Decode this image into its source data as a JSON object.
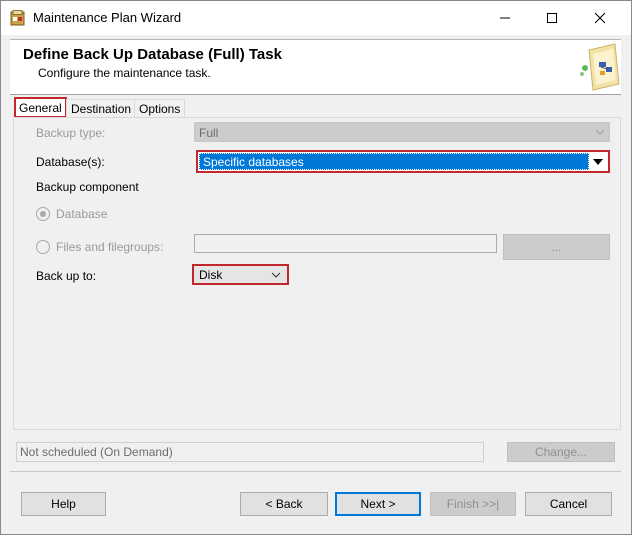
{
  "window": {
    "title": "Maintenance Plan Wizard",
    "min_glyph": "—",
    "max_glyph": "☐",
    "close_glyph": "✕"
  },
  "header": {
    "title": "Define Back Up Database (Full) Task",
    "subtitle": "Configure the maintenance task."
  },
  "tabs": [
    {
      "label": "General",
      "active": true
    },
    {
      "label": "Destination",
      "active": false
    },
    {
      "label": "Options",
      "active": false
    }
  ],
  "general": {
    "backup_type_label": "Backup type:",
    "backup_type_value": "Full",
    "databases_label": "Database(s):",
    "databases_value": "Specific databases",
    "backup_component_label": "Backup component",
    "radio_database_label": "Database",
    "radio_files_label": "Files and filegroups:",
    "browse_label": "...",
    "back_up_to_label": "Back up to:",
    "back_up_to_value": "Disk"
  },
  "schedule": {
    "text": "Not scheduled (On Demand)",
    "change_label": "Change..."
  },
  "footer": {
    "help": "Help",
    "back": "< Back",
    "next": "Next >",
    "finish": "Finish >>|",
    "cancel": "Cancel"
  },
  "colors": {
    "highlight_border": "#c1272d",
    "selection": "#0078d7",
    "disabled_text": "#9a9a9a"
  },
  "icons": [
    "app-icon",
    "minimize-icon",
    "maximize-icon",
    "close-icon",
    "wizard-graphic-icon",
    "chevron-down-icon"
  ]
}
